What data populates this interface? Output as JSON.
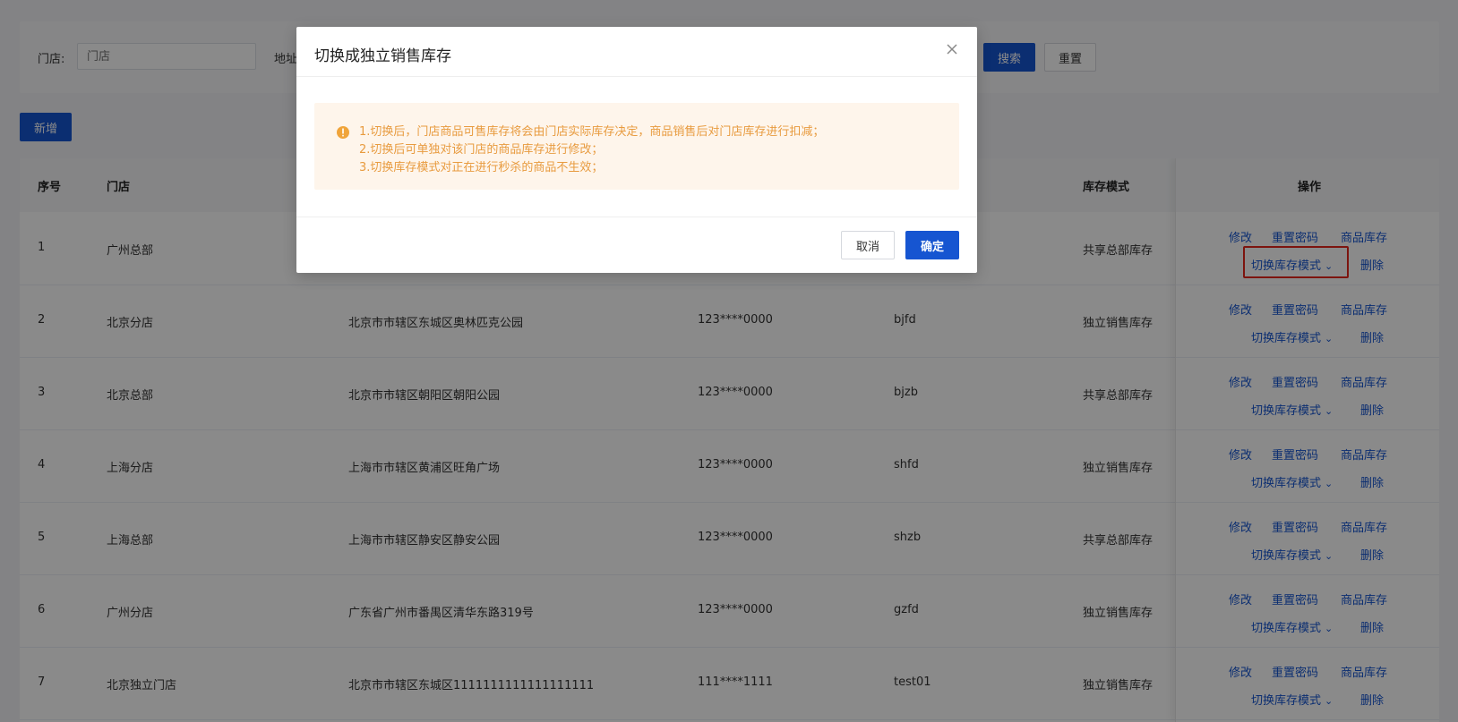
{
  "filter": {
    "store_label": "门店:",
    "store_placeholder": "门店",
    "address_label": "地址",
    "search_label": "搜索",
    "reset_label": "重置"
  },
  "toolbar": {
    "add_label": "新增"
  },
  "table": {
    "headers": {
      "index": "序号",
      "store": "门店",
      "stock_mode": "库存模式",
      "actions": "操作"
    },
    "rows": [
      {
        "index": "1",
        "store": "广州总部",
        "address": "",
        "phone": "",
        "account": "",
        "mode": "共享总部库存"
      },
      {
        "index": "2",
        "store": "北京分店",
        "address": "北京市市辖区东城区奥林匹克公园",
        "phone": "123****0000",
        "account": "bjfd",
        "mode": "独立销售库存"
      },
      {
        "index": "3",
        "store": "北京总部",
        "address": "北京市市辖区朝阳区朝阳公园",
        "phone": "123****0000",
        "account": "bjzb",
        "mode": "共享总部库存"
      },
      {
        "index": "4",
        "store": "上海分店",
        "address": "上海市市辖区黄浦区旺角广场",
        "phone": "123****0000",
        "account": "shfd",
        "mode": "独立销售库存"
      },
      {
        "index": "5",
        "store": "上海总部",
        "address": "上海市市辖区静安区静安公园",
        "phone": "123****0000",
        "account": "shzb",
        "mode": "共享总部库存"
      },
      {
        "index": "6",
        "store": "广州分店",
        "address": "广东省广州市番禺区清华东路319号",
        "phone": "123****0000",
        "account": "gzfd",
        "mode": "独立销售库存"
      },
      {
        "index": "7",
        "store": "北京独立门店",
        "address": "北京市市辖区东城区1111111111111111111",
        "phone": "111****1111",
        "account": "test01",
        "mode": "独立销售库存"
      }
    ],
    "actions": {
      "edit": "修改",
      "reset_password": "重置密码",
      "product_stock": "商品库存",
      "switch_mode": "切换库存模式",
      "delete": "删除"
    }
  },
  "modal": {
    "title": "切换成独立销售库存",
    "notes": [
      "1.切换后，门店商品可售库存将会由门店实际库存决定，商品销售后对门店库存进行扣减；",
      "2.切换后可单独对该门店的商品库存进行修改；",
      "3.切换库存模式对正在进行秒杀的商品不生效；"
    ],
    "cancel_label": "取消",
    "confirm_label": "确定"
  },
  "colors": {
    "primary": "#1655d1",
    "warning_text": "#e89b3f",
    "warning_bg": "#fef5eb",
    "highlight": "#e8261a"
  }
}
